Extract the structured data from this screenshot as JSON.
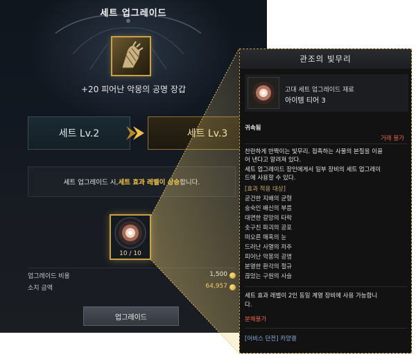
{
  "panel": {
    "title": "세트 업그레이드",
    "item_name": "+20 피어난 악몽의 공명 장갑",
    "from_level": "세트 Lv.2",
    "to_level": "세트 Lv.3",
    "notice_prefix": "세트 업그레이드 시, ",
    "notice_highlight": "세트 효과 레벨이 상승",
    "notice_suffix": "합니다.",
    "material_count": "10 / 10",
    "cost_label": "업그레이드 비용",
    "cost_value": "1,500",
    "owned_label": "소지 금액",
    "owned_value": "64,957",
    "upgrade_button": "업그레이드"
  },
  "tooltip": {
    "title": "관조의 빛무리",
    "category": "고대 세트 업그레이드 재료",
    "tier": "아이템 티어 3",
    "bound": "귀속됨",
    "trade": "거래 불가",
    "desc_lines": [
      "찬란하게 반짝이는 빛무리. 접촉하는 사물의 본질을 이끌",
      "어 낸다고 알려져 있다.",
      "세트 업그레이드 장인에게서 일부 장비의 세트 업그레이",
      "드에 사용할 수 있다."
    ],
    "list_header": "[효과 적용 대상]",
    "targets": [
      "굳건한 지배의 균형",
      "숭숙인 배신의 부름",
      "대면한 갈망의 타락",
      "솟구친 파괴의 공포",
      "떠오른 매혹의 눈",
      "드러난 사멸의 저주",
      "피어난 악몽의 공명",
      "분열한 환각의 절규",
      "끊었는 구원의 사슬"
    ],
    "note_lines": [
      "세트 효과 레벨이 2인 동일 계열 장비에 사용 가능합니",
      "다."
    ],
    "no_disassemble": "분해불가",
    "source": "[어비스 던전] 카양겔"
  },
  "colors": {
    "gold": "#c9a34a",
    "highlight": "#f0c44a",
    "warning": "#e8644a",
    "link": "#8fb0e0"
  }
}
